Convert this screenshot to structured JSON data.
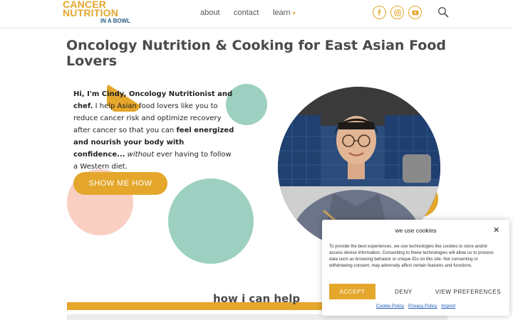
{
  "header": {
    "logo": {
      "line1": "CANCER",
      "line2": "NUTRITION",
      "line3": "IN A BOWL"
    },
    "nav": [
      {
        "label": "about"
      },
      {
        "label": "contact"
      },
      {
        "label": "learn"
      }
    ],
    "social_icons": [
      "facebook-icon",
      "instagram-icon",
      "youtube-icon"
    ],
    "search_icon": "search-icon"
  },
  "hero": {
    "title": "Oncology Nutrition & Cooking for East Asian Food Lovers",
    "intro": {
      "greeting": "Hi, I'm Cindy, Oncology Nutritionist and chef.",
      "body1": " I help Asian food lovers like you to reduce cancer risk and optimize recovery after cancer so that you can ",
      "emphasis": "feel energized and nourish your body with confidence...",
      "italic": " without",
      "body2": " ever having to follow a Western diet."
    },
    "cta_label": "SHOW ME HOW"
  },
  "help": {
    "title": "how i can help"
  },
  "cookie": {
    "title": "we use cookies",
    "text": "To provide the best experiences, we use technologies like cookies to store and/or access device information. Consenting to these technologies will allow us to process data such as browsing behavior or unique IDs on this site. Not consenting or withdrawing consent, may adversely affect certain features and functions.",
    "accept": "ACCEPT",
    "deny": "DENY",
    "preferences": "VIEW PREFERENCES",
    "links": [
      "Cookie Policy",
      "Privacy Policy",
      "Imprint"
    ]
  },
  "colors": {
    "accent": "#e4a72c",
    "teal": "#9dd0c0",
    "peach": "#f9cfc1",
    "link": "#1a57b8"
  }
}
